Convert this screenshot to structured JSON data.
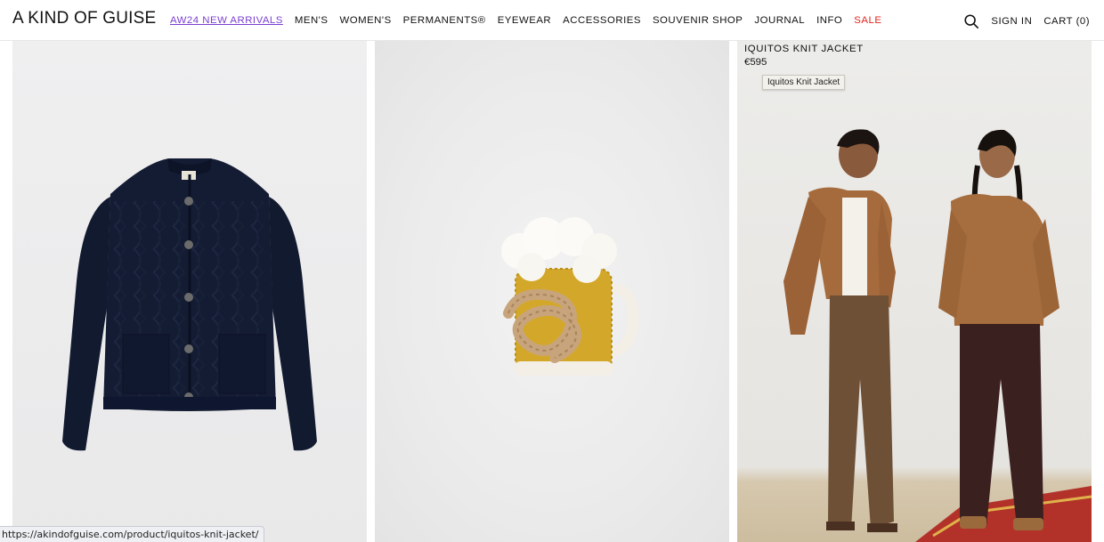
{
  "header": {
    "logo": "A KIND OF GUISE",
    "nav": [
      {
        "label": "AW24 NEW ARRIVALS"
      },
      {
        "label": "MEN'S"
      },
      {
        "label": "WOMEN'S"
      },
      {
        "label": "PERMANENTS®"
      },
      {
        "label": "EYEWEAR"
      },
      {
        "label": "ACCESSORIES"
      },
      {
        "label": "SOUVENIR SHOP"
      },
      {
        "label": "JOURNAL"
      },
      {
        "label": "INFO"
      },
      {
        "label": "SALE"
      }
    ],
    "sign_in": "SIGN IN",
    "cart": "CART (0)"
  },
  "products": [
    {
      "name": "",
      "price": ""
    },
    {
      "name": "",
      "price": ""
    },
    {
      "name": "IQUITOS KNIT JACKET",
      "price": "€595",
      "tooltip": "Iquitos Knit Jacket"
    }
  ],
  "status_bar": {
    "url": "https://akindofguise.com/product/iquitos-knit-jacket/"
  },
  "colors": {
    "accent": "#7a3fd0",
    "sale": "#e0261f"
  },
  "icons": {
    "search": "search-icon"
  }
}
